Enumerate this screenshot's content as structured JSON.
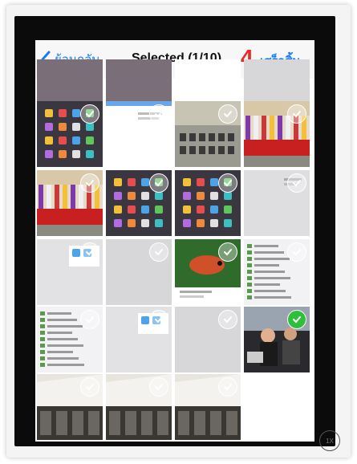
{
  "navbar": {
    "back_label": "ย้อนกลับ",
    "title": "Selected (1/10)",
    "step_marker": "4.",
    "done_label": "เสร็จสิ้น"
  },
  "photos": [
    {
      "name": "partial-top",
      "kind": "partial",
      "selected": false
    },
    {
      "name": "partial-top",
      "kind": "partial",
      "selected": false
    },
    {
      "name": "partial-top",
      "kind": "doc-partial",
      "selected": false
    },
    {
      "name": "partial-top",
      "kind": "blank",
      "selected": false
    },
    {
      "name": "ipad-homescreen",
      "kind": "ipad",
      "selected": false
    },
    {
      "name": "screenshot",
      "kind": "doc",
      "selected": false
    },
    {
      "name": "hall-chairs",
      "kind": "hall",
      "selected": false
    },
    {
      "name": "stage-person",
      "kind": "stage",
      "selected": false
    },
    {
      "name": "stage",
      "kind": "stage",
      "selected": false
    },
    {
      "name": "ipad-homescreen",
      "kind": "ipad",
      "selected": false
    },
    {
      "name": "ipad-homescreen",
      "kind": "ipad",
      "selected": false
    },
    {
      "name": "screenshot",
      "kind": "blank-doc",
      "selected": false
    },
    {
      "name": "screenshot",
      "kind": "grey-doc",
      "selected": false
    },
    {
      "name": "screenshot",
      "kind": "blank",
      "selected": false
    },
    {
      "name": "fish",
      "kind": "fish",
      "selected": false
    },
    {
      "name": "settings-list",
      "kind": "list",
      "selected": false
    },
    {
      "name": "settings-list",
      "kind": "list",
      "selected": false
    },
    {
      "name": "screenshot",
      "kind": "grey-doc",
      "selected": false
    },
    {
      "name": "screenshot",
      "kind": "blank",
      "selected": false
    },
    {
      "name": "people-meeting",
      "kind": "people",
      "selected": true
    },
    {
      "name": "building",
      "kind": "building",
      "selected": false
    },
    {
      "name": "building",
      "kind": "building",
      "selected": false
    },
    {
      "name": "building",
      "kind": "building",
      "selected": false
    }
  ],
  "corner_badge": "1X"
}
